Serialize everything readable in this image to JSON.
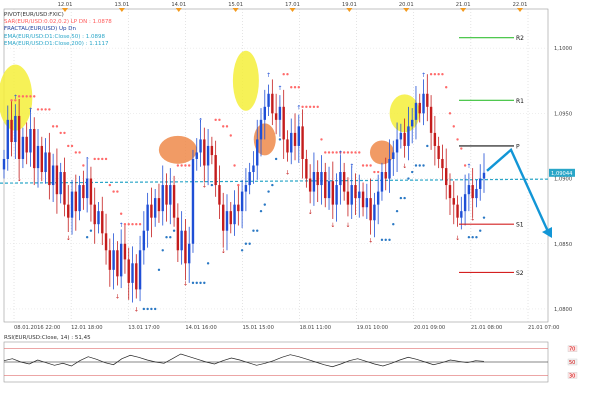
{
  "legend": {
    "symbol": "PIVOT(EUR/USD:FXIC)",
    "sar": "SAR(EUR/USD:0.02,0.2)   LP  DN : 1.0878",
    "fractal": "FRACTAL(EUR/USD)     Up  Dn",
    "ema50": "EMA(EUR/USD:D1:Close,50) : 1.0898",
    "ema200": "EMA(EUR/USD:D1:Close,200) : 1.1117"
  },
  "rsi_title": "RSI(EUR/USD:Close, 14) : 51,45",
  "colors": {
    "bull": "#1f4fd6",
    "bear": "#c41c1c",
    "sar": "#ff6a6a",
    "sar_up": "#2a78c4",
    "ema": "#2aa6c8",
    "highlight_yellow": "#f4ee3a",
    "highlight_orange": "#ee8a4a",
    "r_level": "#36c036",
    "s_level": "#d42020",
    "pivot_level": "#111111",
    "arrow": "#1296d6"
  },
  "chart_data": {
    "type": "candlestick",
    "top_dates": [
      "12.01",
      "13.01",
      "14.01",
      "15.01",
      "17.01",
      "19.01",
      "20.01",
      "21.01",
      "22.01"
    ],
    "bottom_dates": [
      "08.01.2016 22:00",
      "12.01 18:00",
      "13.01 17:00",
      "14.01 16:00",
      "15.01 15:00",
      "18.01 11:00",
      "19.01 10:00",
      "20.01 09:00",
      "21.01 08:00",
      "21.01 07:00"
    ],
    "y_ticks": [
      "1,1000",
      "1,0950",
      "1,0900",
      "1,0850",
      "1,0800"
    ],
    "ylim": [
      1.079,
      1.103
    ],
    "current_price_label": "1,09044",
    "close": [
      1.0915,
      1.0945,
      1.0928,
      1.0948,
      1.0915,
      1.0932,
      1.092,
      1.0938,
      1.0908,
      1.0925,
      1.0905,
      1.092,
      1.0895,
      1.091,
      1.0888,
      1.0905,
      1.088,
      1.087,
      1.089,
      1.0875,
      1.0895,
      1.0885,
      1.09,
      1.088,
      1.0865,
      1.0875,
      1.0858,
      1.0845,
      1.083,
      1.0845,
      1.0825,
      1.085,
      1.0838,
      1.082,
      1.0835,
      1.0815,
      1.0845,
      1.086,
      1.088,
      1.087,
      1.0885,
      1.0875,
      1.0895,
      1.088,
      1.0895,
      1.087,
      1.0845,
      1.086,
      1.0835,
      1.085,
      1.0915,
      1.092,
      1.093,
      1.091,
      1.0925,
      1.0918,
      1.0895,
      1.088,
      1.086,
      1.0875,
      1.0865,
      1.088,
      1.0875,
      1.089,
      1.0895,
      1.0905,
      1.091,
      1.093,
      1.0945,
      1.0955,
      1.0965,
      1.095,
      1.0945,
      1.0955,
      1.093,
      1.092,
      1.0935,
      1.0925,
      1.094,
      1.0915,
      1.09,
      1.089,
      1.0905,
      1.0895,
      1.0905,
      1.0885,
      1.0898,
      1.088,
      1.0895,
      1.0905,
      1.089,
      1.088,
      1.0895,
      1.0885,
      1.089,
      1.0878,
      1.0885,
      1.0868,
      1.088,
      1.089,
      1.0905,
      1.09,
      1.0915,
      1.092,
      1.093,
      1.0935,
      1.0925,
      1.094,
      1.0945,
      1.0958,
      1.095,
      1.0965,
      1.0955,
      1.0935,
      1.0925,
      1.0915,
      1.0908,
      1.0895,
      1.0885,
      1.088,
      1.087,
      1.0875,
      1.0888,
      1.0895,
      1.0885,
      1.0892,
      1.09,
      1.09044
    ],
    "pivot_levels": [
      {
        "label": "R2",
        "value": 1.1008
      },
      {
        "label": "R1",
        "value": 1.096
      },
      {
        "label": "P",
        "value": 1.0925
      },
      {
        "label": "S1",
        "value": 1.0865
      },
      {
        "label": "S2",
        "value": 1.0828
      }
    ],
    "ema_value": 1.0898,
    "rsi": {
      "levels": [
        "70",
        "50",
        "30"
      ],
      "values": [
        52,
        55,
        50,
        47,
        53,
        49,
        45,
        48,
        44,
        52,
        58,
        54,
        49,
        46,
        55,
        60,
        57,
        53,
        50,
        48,
        55,
        62,
        58,
        54,
        50,
        47,
        52,
        56,
        53,
        49,
        45,
        48,
        52,
        57,
        61,
        58,
        54,
        50,
        46,
        43,
        47,
        52,
        55,
        51,
        47,
        44,
        48,
        53,
        57,
        54,
        50,
        46,
        49,
        53,
        51,
        49,
        52,
        51
      ]
    },
    "grid": true
  }
}
